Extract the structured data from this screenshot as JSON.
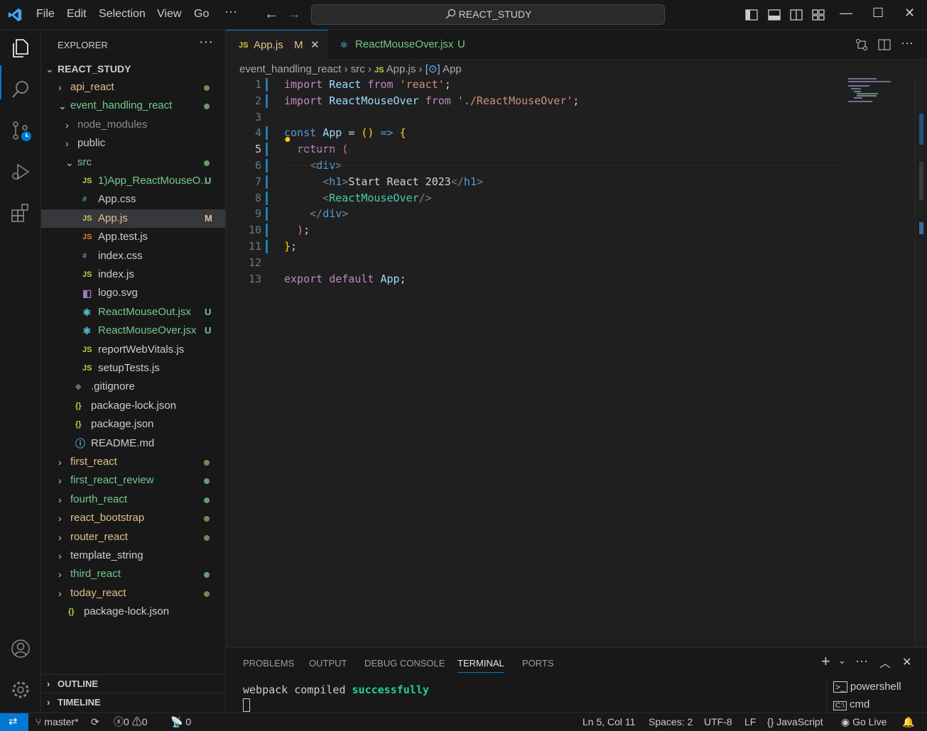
{
  "menu": [
    "File",
    "Edit",
    "Selection",
    "View",
    "Go"
  ],
  "search": {
    "text": "REACT_STUDY"
  },
  "sidebar": {
    "title": "EXPLORER",
    "root": "REACT_STUDY",
    "items": [
      {
        "label": "api_react",
        "type": "folder",
        "open": false,
        "indent": 0,
        "color": "#e2c08d",
        "dot": "#8c7a5b"
      },
      {
        "label": "event_handling_react",
        "type": "folder",
        "open": true,
        "indent": 0,
        "color": "#73c991",
        "dot": "#6b9a6b"
      },
      {
        "label": "node_modules",
        "type": "folder",
        "open": false,
        "indent": 1,
        "color": "#8c8c8c"
      },
      {
        "label": "public",
        "type": "folder",
        "open": false,
        "indent": 1,
        "color": "#cccccc"
      },
      {
        "label": "src",
        "type": "folder",
        "open": true,
        "indent": 1,
        "color": "#73c991",
        "dot": "#6b9a6b"
      },
      {
        "label": "1)App_ReactMouseO...",
        "type": "js",
        "indent": 2,
        "color": "#73c991",
        "badge": "U",
        "badgeColor": "#73c991"
      },
      {
        "label": "App.css",
        "type": "css",
        "indent": 2,
        "color": "#cccccc"
      },
      {
        "label": "App.js",
        "type": "js",
        "indent": 2,
        "color": "#e2c08d",
        "badge": "M",
        "badgeColor": "#e2c08d",
        "selected": true
      },
      {
        "label": "App.test.js",
        "type": "test",
        "indent": 2,
        "color": "#cccccc"
      },
      {
        "label": "index.css",
        "type": "css",
        "indent": 2,
        "color": "#cccccc"
      },
      {
        "label": "index.js",
        "type": "js",
        "indent": 2,
        "color": "#cccccc"
      },
      {
        "label": "logo.svg",
        "type": "svg",
        "indent": 2,
        "color": "#cccccc"
      },
      {
        "label": "ReactMouseOut.jsx",
        "type": "react",
        "indent": 2,
        "color": "#73c991",
        "badge": "U",
        "badgeColor": "#73c991"
      },
      {
        "label": "ReactMouseOver.jsx",
        "type": "react",
        "indent": 2,
        "color": "#73c991",
        "badge": "U",
        "badgeColor": "#73c991"
      },
      {
        "label": "reportWebVitals.js",
        "type": "js",
        "indent": 2,
        "color": "#cccccc"
      },
      {
        "label": "setupTests.js",
        "type": "js",
        "indent": 2,
        "color": "#cccccc"
      },
      {
        "label": ".gitignore",
        "type": "git",
        "indent": 1,
        "color": "#cccccc"
      },
      {
        "label": "package-lock.json",
        "type": "json",
        "indent": 1,
        "color": "#cccccc"
      },
      {
        "label": "package.json",
        "type": "json",
        "indent": 1,
        "color": "#cccccc"
      },
      {
        "label": "README.md",
        "type": "info",
        "indent": 1,
        "color": "#cccccc"
      },
      {
        "label": "first_react",
        "type": "folder",
        "open": false,
        "indent": 0,
        "color": "#e2c08d",
        "dot": "#8c7a5b"
      },
      {
        "label": "first_react_review",
        "type": "folder",
        "open": false,
        "indent": 0,
        "color": "#73c991",
        "dot": "#6b9a6b"
      },
      {
        "label": "fourth_react",
        "type": "folder",
        "open": false,
        "indent": 0,
        "color": "#73c991",
        "dot": "#6b9a6b"
      },
      {
        "label": "react_bootstrap",
        "type": "folder",
        "open": false,
        "indent": 0,
        "color": "#e2c08d",
        "dot": "#8c7a5b"
      },
      {
        "label": "router_react",
        "type": "folder",
        "open": false,
        "indent": 0,
        "color": "#e2c08d",
        "dot": "#8c7a5b"
      },
      {
        "label": "template_string",
        "type": "folder",
        "open": false,
        "indent": 0,
        "color": "#cccccc"
      },
      {
        "label": "third_react",
        "type": "folder",
        "open": false,
        "indent": 0,
        "color": "#73c991",
        "dot": "#6b9a6b"
      },
      {
        "label": "today_react",
        "type": "folder",
        "open": false,
        "indent": 0,
        "color": "#e2c08d",
        "dot": "#8c7a5b"
      },
      {
        "label": "package-lock.json",
        "type": "json",
        "indent": 0,
        "color": "#cccccc"
      }
    ],
    "outline": "OUTLINE",
    "timeline": "TIMELINE"
  },
  "tabs": [
    {
      "label": "App.js",
      "badge": "M",
      "active": true
    },
    {
      "label": "ReactMouseOver.jsx",
      "badge": "U",
      "active": false
    }
  ],
  "breadcrumbs": [
    "event_handling_react",
    "src",
    "App.js",
    "App"
  ],
  "code": {
    "current_line": 5,
    "lines": [
      [
        [
          "kw",
          "import "
        ],
        [
          "id",
          "React "
        ],
        [
          "kw",
          "from "
        ],
        [
          "str",
          "'react'"
        ],
        [
          "pl",
          ";"
        ]
      ],
      [
        [
          "kw",
          "import "
        ],
        [
          "id",
          "ReactMouseOver "
        ],
        [
          "kw",
          "from "
        ],
        [
          "str",
          "'./ReactMouseOver'"
        ],
        [
          "pl",
          ";"
        ]
      ],
      [],
      [
        [
          "cn",
          "const "
        ],
        [
          "id",
          "App "
        ],
        [
          "pl",
          "= "
        ],
        [
          "yb",
          "() "
        ],
        [
          "cn",
          "=> "
        ],
        [
          "yb",
          "{"
        ]
      ],
      [
        [
          "pl",
          "  "
        ],
        [
          "kw",
          "return "
        ],
        [
          "mb",
          "("
        ]
      ],
      [
        [
          "pl",
          "    "
        ],
        [
          "gy",
          "<"
        ],
        [
          "tg",
          "div"
        ],
        [
          "gy",
          ">"
        ]
      ],
      [
        [
          "pl",
          "      "
        ],
        [
          "gy",
          "<"
        ],
        [
          "tg",
          "h1"
        ],
        [
          "gy",
          ">"
        ],
        [
          "pl",
          "Start React 2023"
        ],
        [
          "gy",
          "</"
        ],
        [
          "tg",
          "h1"
        ],
        [
          "gy",
          ">"
        ]
      ],
      [
        [
          "pl",
          "      "
        ],
        [
          "gy",
          "<"
        ],
        [
          "fn",
          "ReactMouseOver"
        ],
        [
          "gy",
          "/>"
        ]
      ],
      [
        [
          "pl",
          "    "
        ],
        [
          "gy",
          "</"
        ],
        [
          "tg",
          "div"
        ],
        [
          "gy",
          ">"
        ]
      ],
      [
        [
          "pl",
          "  "
        ],
        [
          "mb",
          ")"
        ],
        [
          "pl",
          ";"
        ]
      ],
      [
        [
          "yb",
          "}"
        ],
        [
          "pl",
          ";"
        ]
      ],
      [],
      [
        [
          "kw",
          "export "
        ],
        [
          "kw",
          "default "
        ],
        [
          "id",
          "App"
        ],
        [
          "pl",
          ";"
        ]
      ]
    ]
  },
  "panel": {
    "tabs": [
      "PROBLEMS",
      "OUTPUT",
      "DEBUG CONSOLE",
      "TERMINAL",
      "PORTS"
    ],
    "active_tab": "TERMINAL",
    "terminal_text": "webpack compiled ",
    "terminal_success": "successfully",
    "terminals": [
      "powershell",
      "cmd"
    ]
  },
  "status": {
    "branch": "master*",
    "errors": "0",
    "warnings": "0",
    "ports": "0",
    "position": "Ln 5, Col 11",
    "spaces": "Spaces: 2",
    "encoding": "UTF-8",
    "eol": "LF",
    "language": "JavaScript",
    "golive": "Go Live"
  },
  "colors": {
    "accent": "#0078d4",
    "modified": "#e2c08d",
    "untracked": "#73c991"
  }
}
